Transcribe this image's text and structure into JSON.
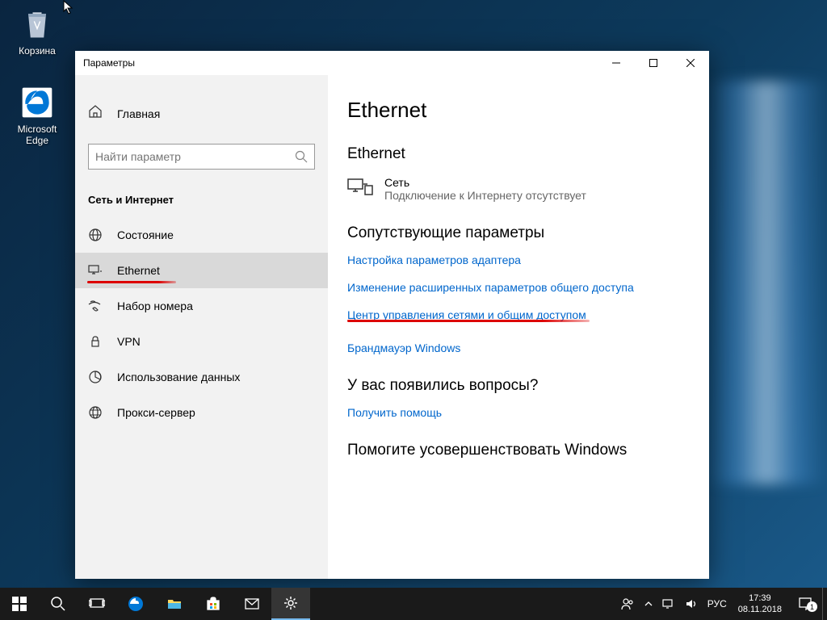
{
  "desktop": {
    "recycle_bin": "Корзина",
    "edge": "Microsoft Edge"
  },
  "window": {
    "title": "Параметры",
    "sidebar": {
      "home": "Главная",
      "search_placeholder": "Найти параметр",
      "section": "Сеть и Интернет",
      "items": [
        {
          "label": "Состояние"
        },
        {
          "label": "Ethernet"
        },
        {
          "label": "Набор номера"
        },
        {
          "label": "VPN"
        },
        {
          "label": "Использование данных"
        },
        {
          "label": "Прокси-сервер"
        }
      ]
    },
    "main": {
      "title": "Ethernet",
      "network_heading": "Ethernet",
      "network_name": "Сеть",
      "network_status": "Подключение к Интернету отсутствует",
      "related_heading": "Сопутствующие параметры",
      "link_adapter": "Настройка параметров адаптера",
      "link_sharing": "Изменение расширенных параметров общего доступа",
      "link_center": "Центр управления сетями и общим доступом",
      "link_firewall": "Брандмауэр Windows",
      "questions_heading": "У вас появились вопросы?",
      "link_help": "Получить помощь",
      "improve_heading": "Помогите усовершенствовать Windows"
    }
  },
  "taskbar": {
    "lang": "РУС",
    "time": "17:39",
    "date": "08.11.2018",
    "notif_count": "1"
  }
}
